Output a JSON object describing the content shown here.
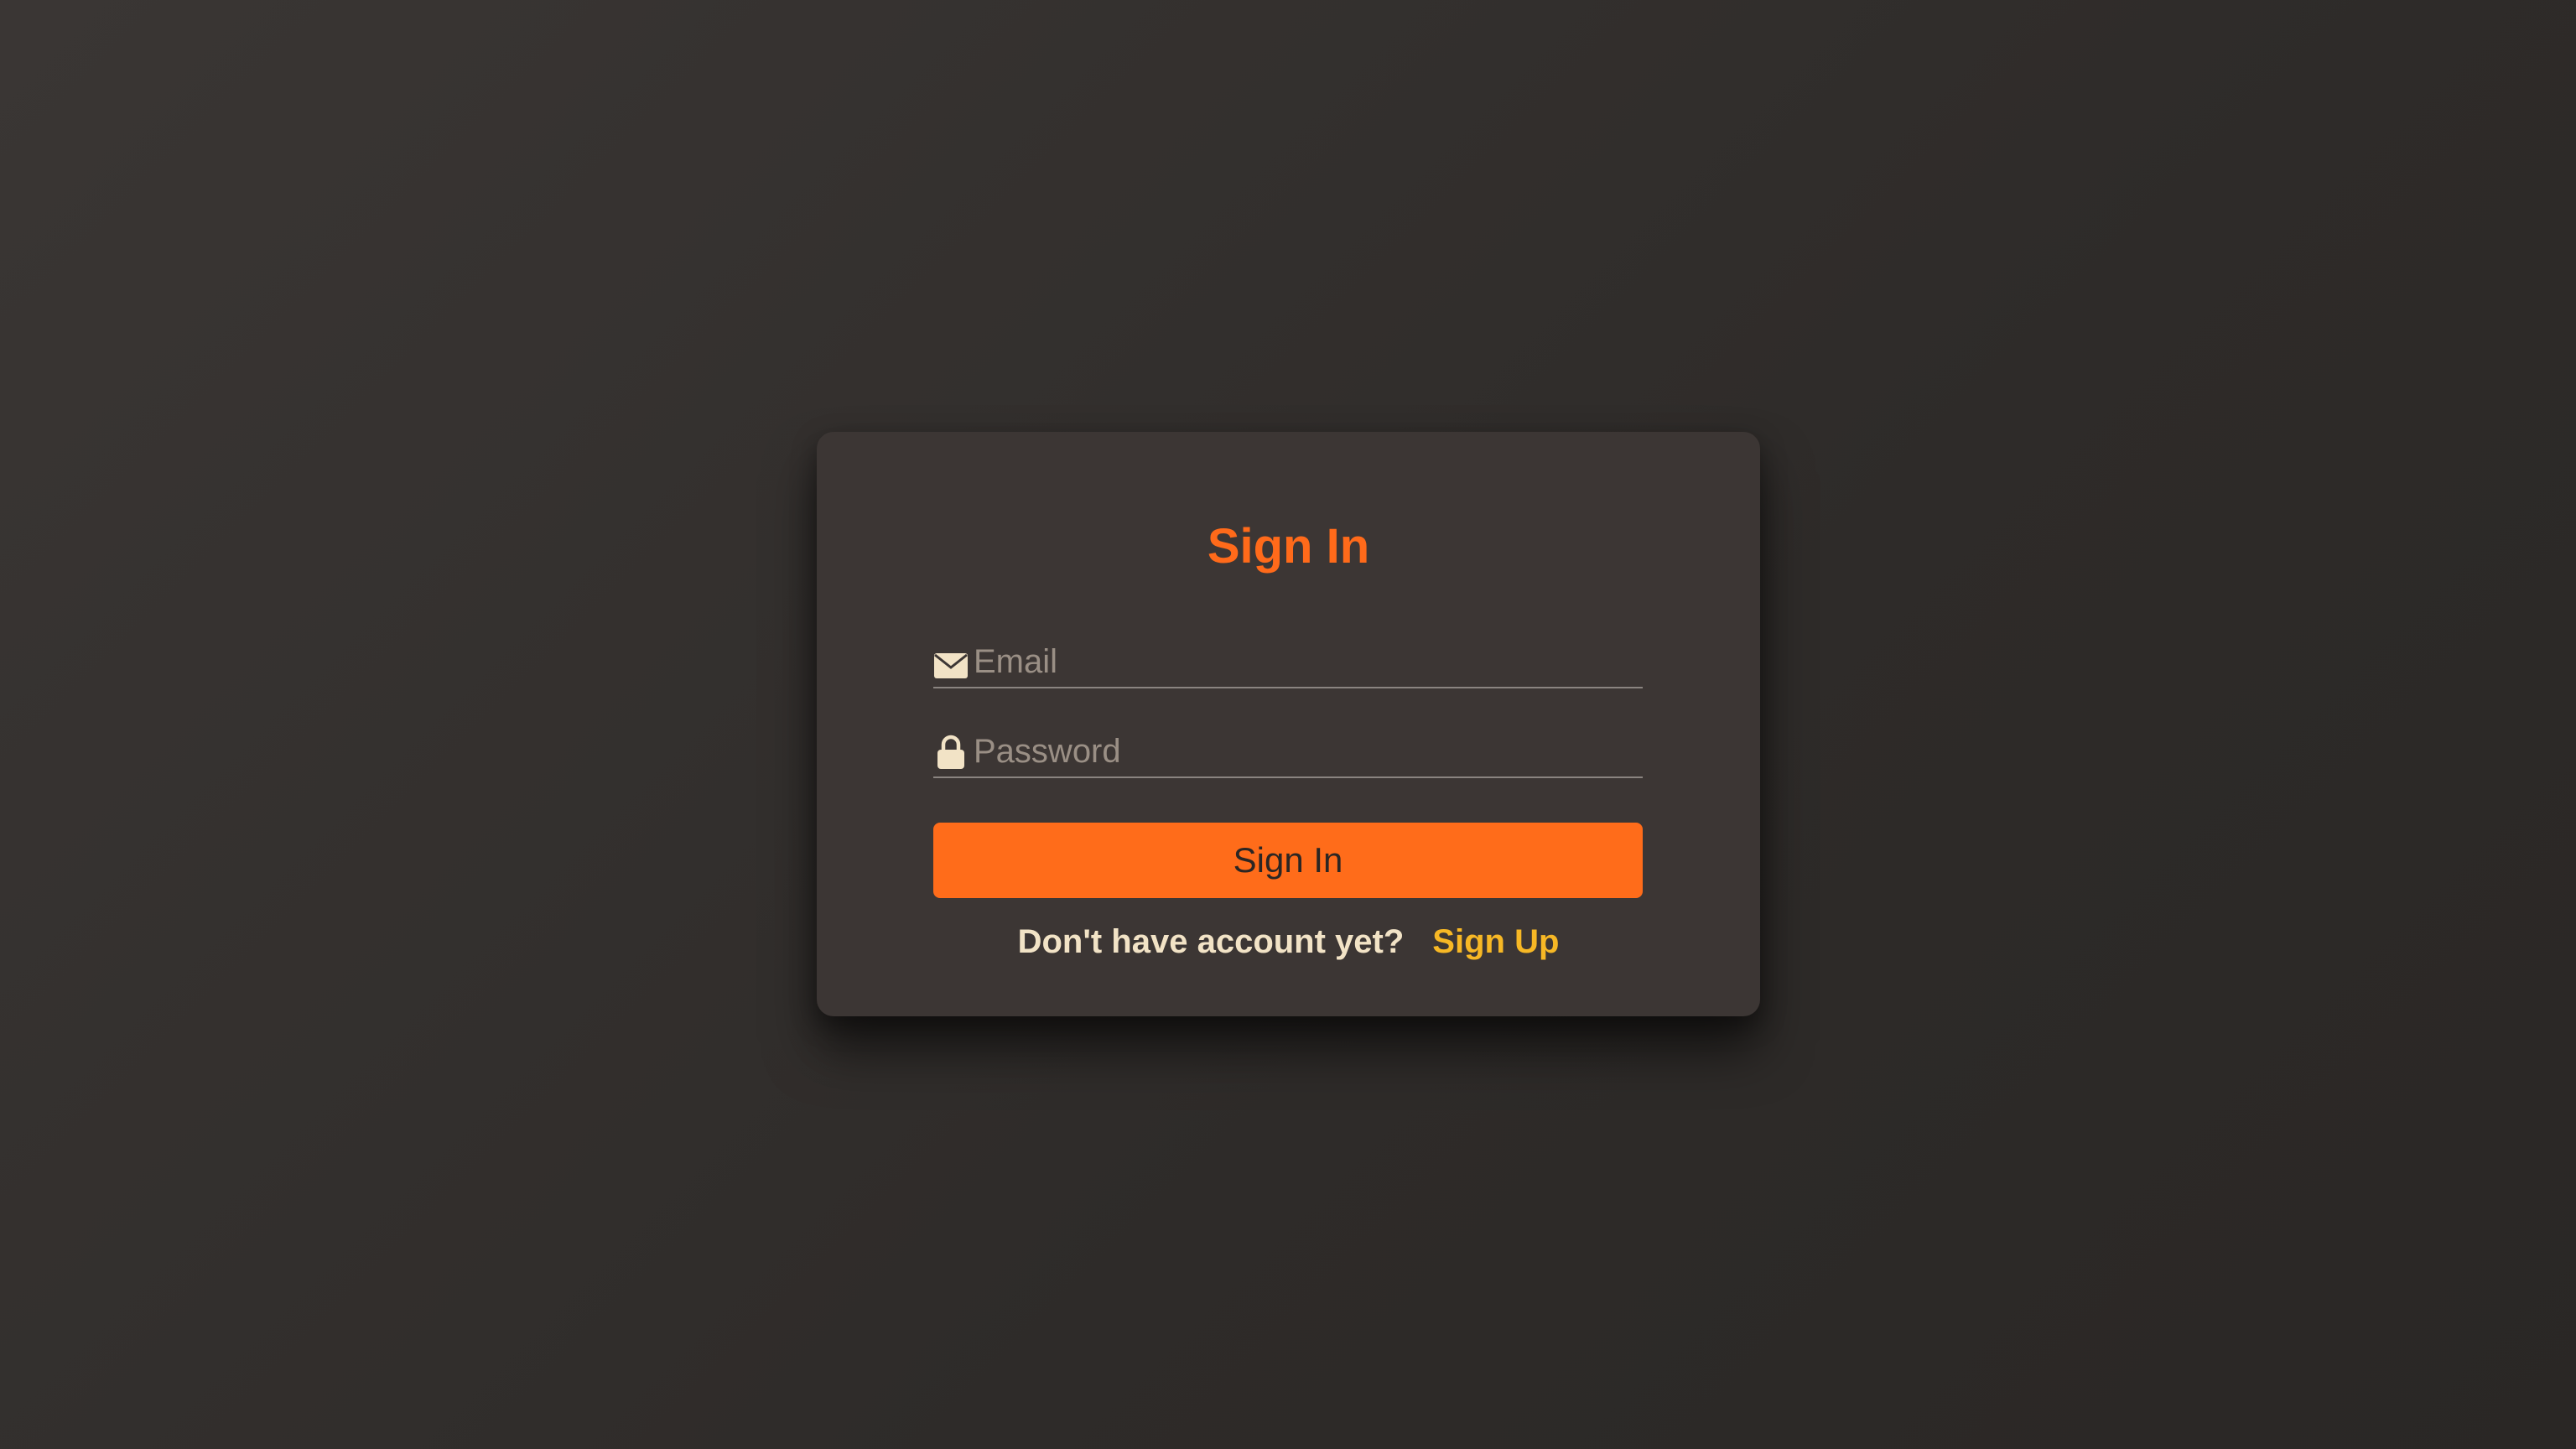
{
  "signin": {
    "title": "Sign In",
    "email": {
      "icon": "envelope-icon",
      "placeholder": "Email",
      "value": ""
    },
    "password": {
      "icon": "lock-icon",
      "placeholder": "Password",
      "value": ""
    },
    "submit_label": "Sign In",
    "footer": {
      "prompt": "Don't have account yet?",
      "link_label": "Sign Up"
    }
  },
  "colors": {
    "accent": "#ff6c1a",
    "link": "#f7b825",
    "card": "#3c3634",
    "icon": "#f2e3c6"
  }
}
